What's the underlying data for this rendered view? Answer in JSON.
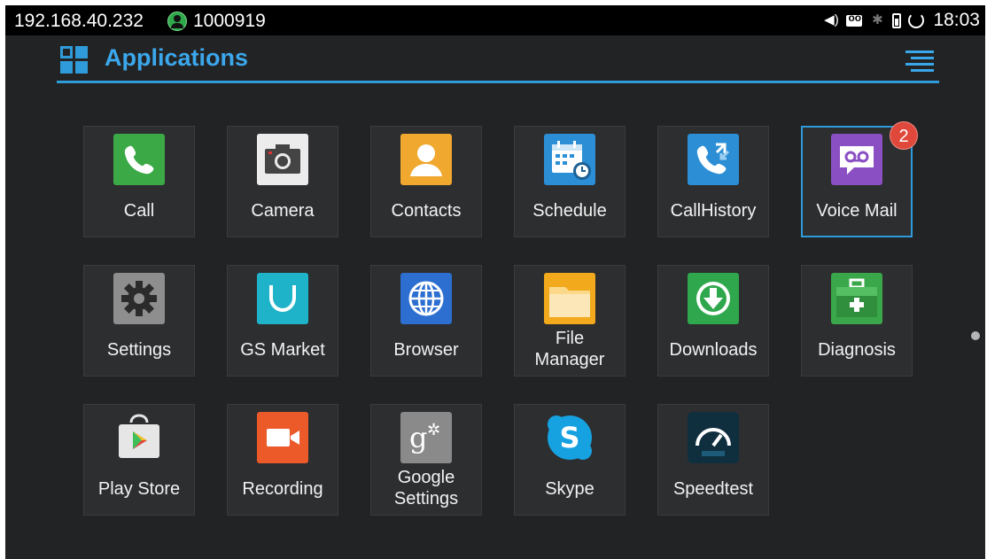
{
  "status": {
    "ip": "192.168.40.232",
    "account": "1000919",
    "time": "18:03"
  },
  "header": {
    "title": "Applications"
  },
  "apps": [
    {
      "id": "call",
      "label": "Call"
    },
    {
      "id": "camera",
      "label": "Camera"
    },
    {
      "id": "contacts",
      "label": "Contacts"
    },
    {
      "id": "schedule",
      "label": "Schedule"
    },
    {
      "id": "callhistory",
      "label": "CallHistory"
    },
    {
      "id": "voicemail",
      "label": "Voice Mail",
      "badge": "2"
    },
    {
      "id": "settings",
      "label": "Settings"
    },
    {
      "id": "gsmarket",
      "label": "GS Market"
    },
    {
      "id": "browser",
      "label": "Browser"
    },
    {
      "id": "filemanager",
      "label_line1": "File",
      "label_line2": "Manager"
    },
    {
      "id": "downloads",
      "label": "Downloads"
    },
    {
      "id": "diagnosis",
      "label": "Diagnosis"
    },
    {
      "id": "playstore",
      "label": "Play Store"
    },
    {
      "id": "recording",
      "label": "Recording"
    },
    {
      "id": "googlesettings",
      "label_line1": "Google",
      "label_line2": "Settings"
    },
    {
      "id": "skype",
      "label": "Skype"
    },
    {
      "id": "speedtest",
      "label": "Speedtest"
    }
  ],
  "colors": {
    "accent": "#2f9bdb",
    "badge": "#e0483c",
    "background": "#222324"
  }
}
